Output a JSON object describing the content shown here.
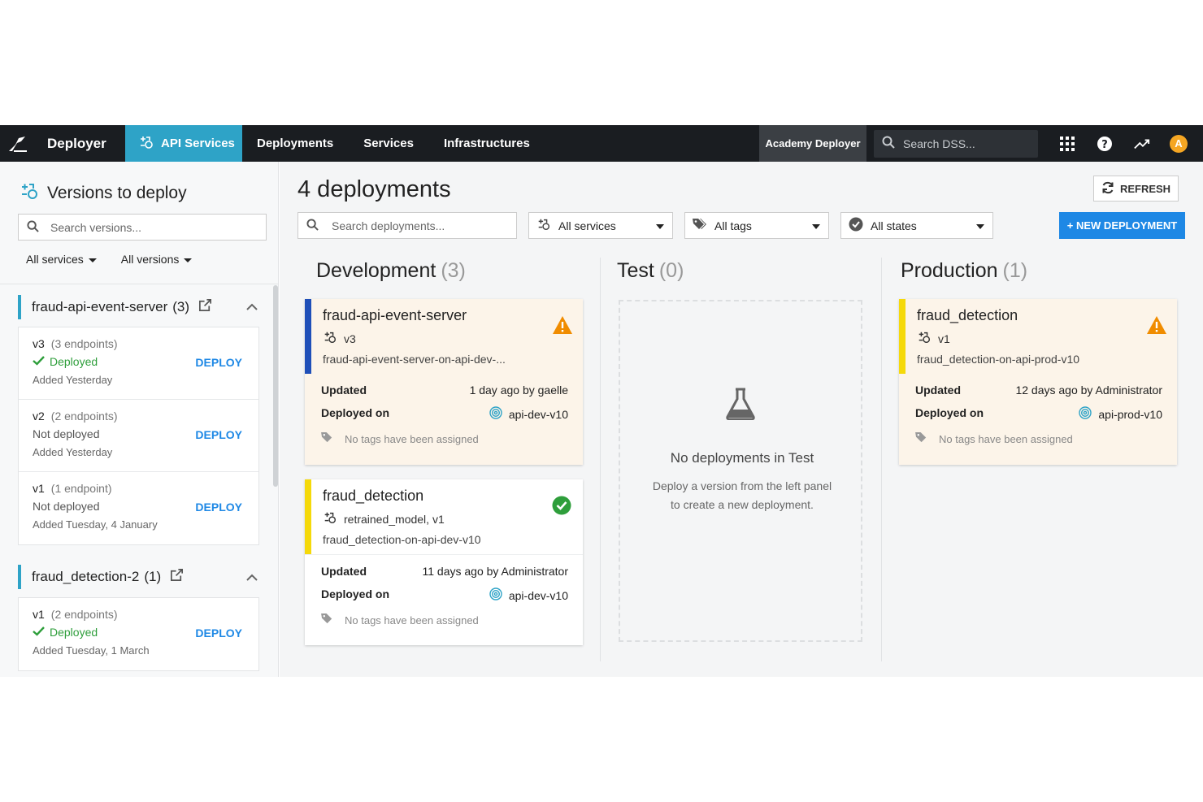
{
  "nav": {
    "brand": "Deployer",
    "api_services": "API Services",
    "links": [
      "Deployments",
      "Services",
      "Infrastructures"
    ],
    "instance": "Academy Deployer",
    "search_placeholder": "Search DSS...",
    "avatar_initial": "A"
  },
  "left": {
    "title": "Versions to deploy",
    "search_placeholder": "Search versions...",
    "filter_services": "All services",
    "filter_versions": "All versions",
    "groups": [
      {
        "name": "fraud-api-event-server",
        "count": "(3)",
        "versions": [
          {
            "version": "v3",
            "endpoints": "(3 endpoints)",
            "status": "Deployed",
            "added": "Added Yesterday",
            "action": "DEPLOY"
          },
          {
            "version": "v2",
            "endpoints": "(2 endpoints)",
            "status": "Not deployed",
            "added": "Added Yesterday",
            "action": "DEPLOY"
          },
          {
            "version": "v1",
            "endpoints": "(1 endpoint)",
            "status": "Not deployed",
            "added": "Added Tuesday, 4 January",
            "action": "DEPLOY"
          }
        ]
      },
      {
        "name": "fraud_detection-2",
        "count": "(1)",
        "versions": [
          {
            "version": "v1",
            "endpoints": "(2 endpoints)",
            "status": "Deployed",
            "added": "Added Tuesday, 1 March",
            "action": "DEPLOY"
          }
        ]
      }
    ]
  },
  "main": {
    "title": "4 deployments",
    "refresh": "REFRESH",
    "search_placeholder": "Search deployments...",
    "filter_services": "All services",
    "filter_tags": "All tags",
    "filter_states": "All states",
    "new_deployment": "+ NEW DEPLOYMENT",
    "columns": [
      {
        "name": "Development",
        "count": "(3)"
      },
      {
        "name": "Test",
        "count": "(0)"
      },
      {
        "name": "Production",
        "count": "(1)"
      }
    ],
    "deployments": [
      {
        "name": "fraud-api-event-server",
        "version": "v3",
        "instance": "fraud-api-event-server-on-api-dev-...",
        "updated_label": "Updated",
        "updated": "1 day ago by gaelle",
        "deployed_label": "Deployed on",
        "infra": "api-dev-v10",
        "tags": "No tags have been assigned",
        "state": "warning",
        "stripe_color": "#1f4fb8"
      },
      {
        "name": "fraud_detection",
        "version": "retrained_model, v1",
        "instance": "fraud_detection-on-api-dev-v10",
        "updated_label": "Updated",
        "updated": "11 days ago by Administrator",
        "deployed_label": "Deployed on",
        "infra": "api-dev-v10",
        "tags": "No tags have been assigned",
        "state": "healthy",
        "stripe_color": "#f5d90a"
      },
      {
        "name": "fraud_detection",
        "version": "v1",
        "instance": "fraud_detection-on-api-prod-v10",
        "updated_label": "Updated",
        "updated": "12 days ago by Administrator",
        "deployed_label": "Deployed on",
        "infra": "api-prod-v10",
        "tags": "No tags have been assigned",
        "state": "warning",
        "stripe_color": "#f5d90a"
      }
    ],
    "empty_test": {
      "title": "No deployments in Test",
      "line1": "Deploy a version from the left panel",
      "line2": "to create a new deployment."
    }
  },
  "colors": {
    "nav_bg": "#1a1d21",
    "accent": "#2ea3c7",
    "primary_button": "#1e88e5",
    "warning": "#f08c00",
    "success": "#2e9e3b"
  }
}
